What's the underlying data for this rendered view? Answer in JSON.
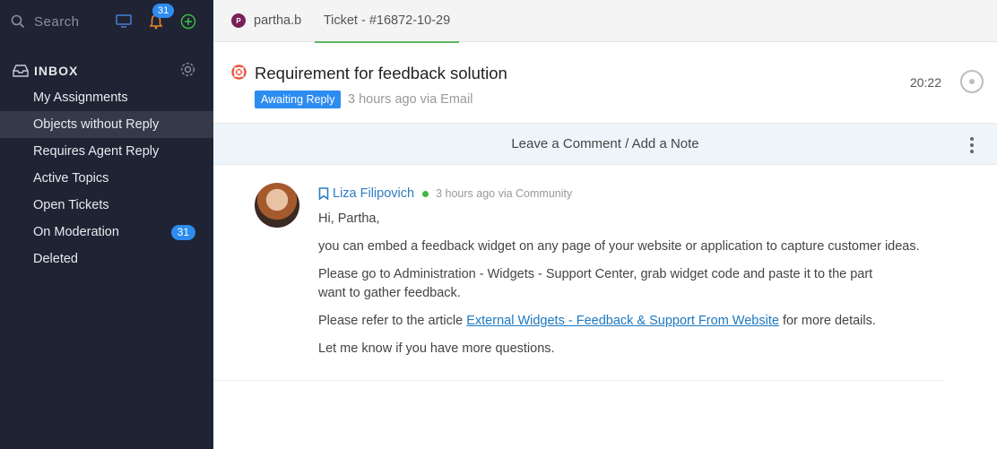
{
  "search": {
    "placeholder": "Search"
  },
  "notifications": {
    "count": "31"
  },
  "inbox": {
    "title": "INBOX",
    "items": [
      {
        "label": "My Assignments"
      },
      {
        "label": "Objects without Reply"
      },
      {
        "label": "Requires Agent Reply"
      },
      {
        "label": "Active Topics"
      },
      {
        "label": "Open Tickets"
      },
      {
        "label": "On Moderation",
        "badge": "31"
      },
      {
        "label": "Deleted"
      }
    ]
  },
  "tabs": {
    "user": {
      "initial": "P",
      "label": "partha.b"
    },
    "ticket": {
      "label": "Ticket - #16872-10-29"
    }
  },
  "ticket": {
    "subject": "Requirement for feedback solution",
    "status": "Awaiting Reply",
    "meta": "3 hours ago via Email",
    "time": "20:22"
  },
  "comment_bar": {
    "label": "Leave a Comment / Add a Note"
  },
  "message": {
    "author": "Liza Filipovich",
    "meta": "3 hours ago via Community",
    "greeting": "Hi, Partha,",
    "p1": "you can embed a feedback widget on any page of your website or application to capture customer ideas.",
    "p2_line1": "Please go to Administration - Widgets - Support Center, grab widget code and paste it to the part",
    "p2_line2": "want to gather feedback.",
    "p3_pre": "Please refer to the article ",
    "p3_link": "External Widgets - Feedback & Support From Website",
    "p3_post": " for more details.",
    "p4": "Let me know if you have more questions."
  },
  "colors": {
    "sidebar": "#1f2333",
    "accent": "#2d8cf0",
    "active_tab": "#5cb85c",
    "link": "#1b78c2"
  }
}
